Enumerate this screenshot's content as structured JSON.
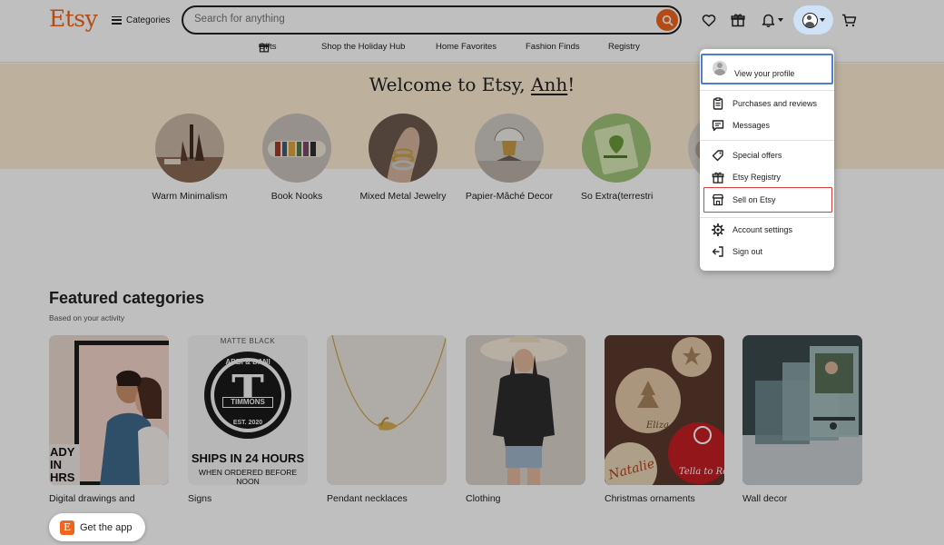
{
  "header": {
    "logo": "Etsy",
    "categories_label": "Categories",
    "search_placeholder": "Search for anything"
  },
  "subnav": {
    "items": [
      "Gifts",
      "Shop the Holiday Hub",
      "Home Favorites",
      "Fashion Finds",
      "Registry"
    ]
  },
  "hero": {
    "welcome_prefix": "Welcome to Etsy, ",
    "user_name": "Anh",
    "welcome_suffix": "!",
    "circles": [
      {
        "label": "Warm Minimalism"
      },
      {
        "label": "Book Nooks"
      },
      {
        "label": "Mixed Metal Jewelry"
      },
      {
        "label": "Papier-Mâché Decor"
      },
      {
        "label": "So Extra(terrestria"
      }
    ]
  },
  "featured": {
    "title": "Featured categories",
    "subtitle": "Based on your activity",
    "cards": [
      {
        "label": "Digital drawings and illustrations",
        "text": "ADY IN HRS"
      },
      {
        "label": "Signs",
        "text_top": "MATTE BLACK",
        "monogram_top": "ABBI & DANI",
        "monogram_letter": "T",
        "monogram_name": "TIMMONS",
        "monogram_est": "EST. 2020",
        "text_big": "SHIPS IN 24 HOURS",
        "text_small": "WHEN ORDERED BEFORE NOON"
      },
      {
        "label": "Pendant necklaces"
      },
      {
        "label": "Clothing"
      },
      {
        "label": "Christmas ornaments",
        "ornament_names": [
          "Eliza",
          "Natalie",
          "Tella to Ro"
        ]
      },
      {
        "label": "Wall decor"
      }
    ]
  },
  "menu": {
    "profile": "View your profile",
    "items": [
      {
        "label": "Purchases and reviews",
        "icon": "clipboard-icon"
      },
      {
        "label": "Messages",
        "icon": "message-icon"
      },
      {
        "label": "Special offers",
        "icon": "tag-icon"
      },
      {
        "label": "Etsy Registry",
        "icon": "gift-icon"
      },
      {
        "label": "Sell on Etsy",
        "icon": "shop-icon"
      },
      {
        "label": "Account settings",
        "icon": "gear-icon"
      },
      {
        "label": "Sign out",
        "icon": "sign-out-icon"
      }
    ]
  },
  "get_app": {
    "icon_letter": "E",
    "label": "Get the app"
  },
  "colors": {
    "brand": "#f1641e",
    "hero_bg": "#fdebd2",
    "highlight_border": "#d9403a",
    "focus_border": "#4b7fd4"
  }
}
